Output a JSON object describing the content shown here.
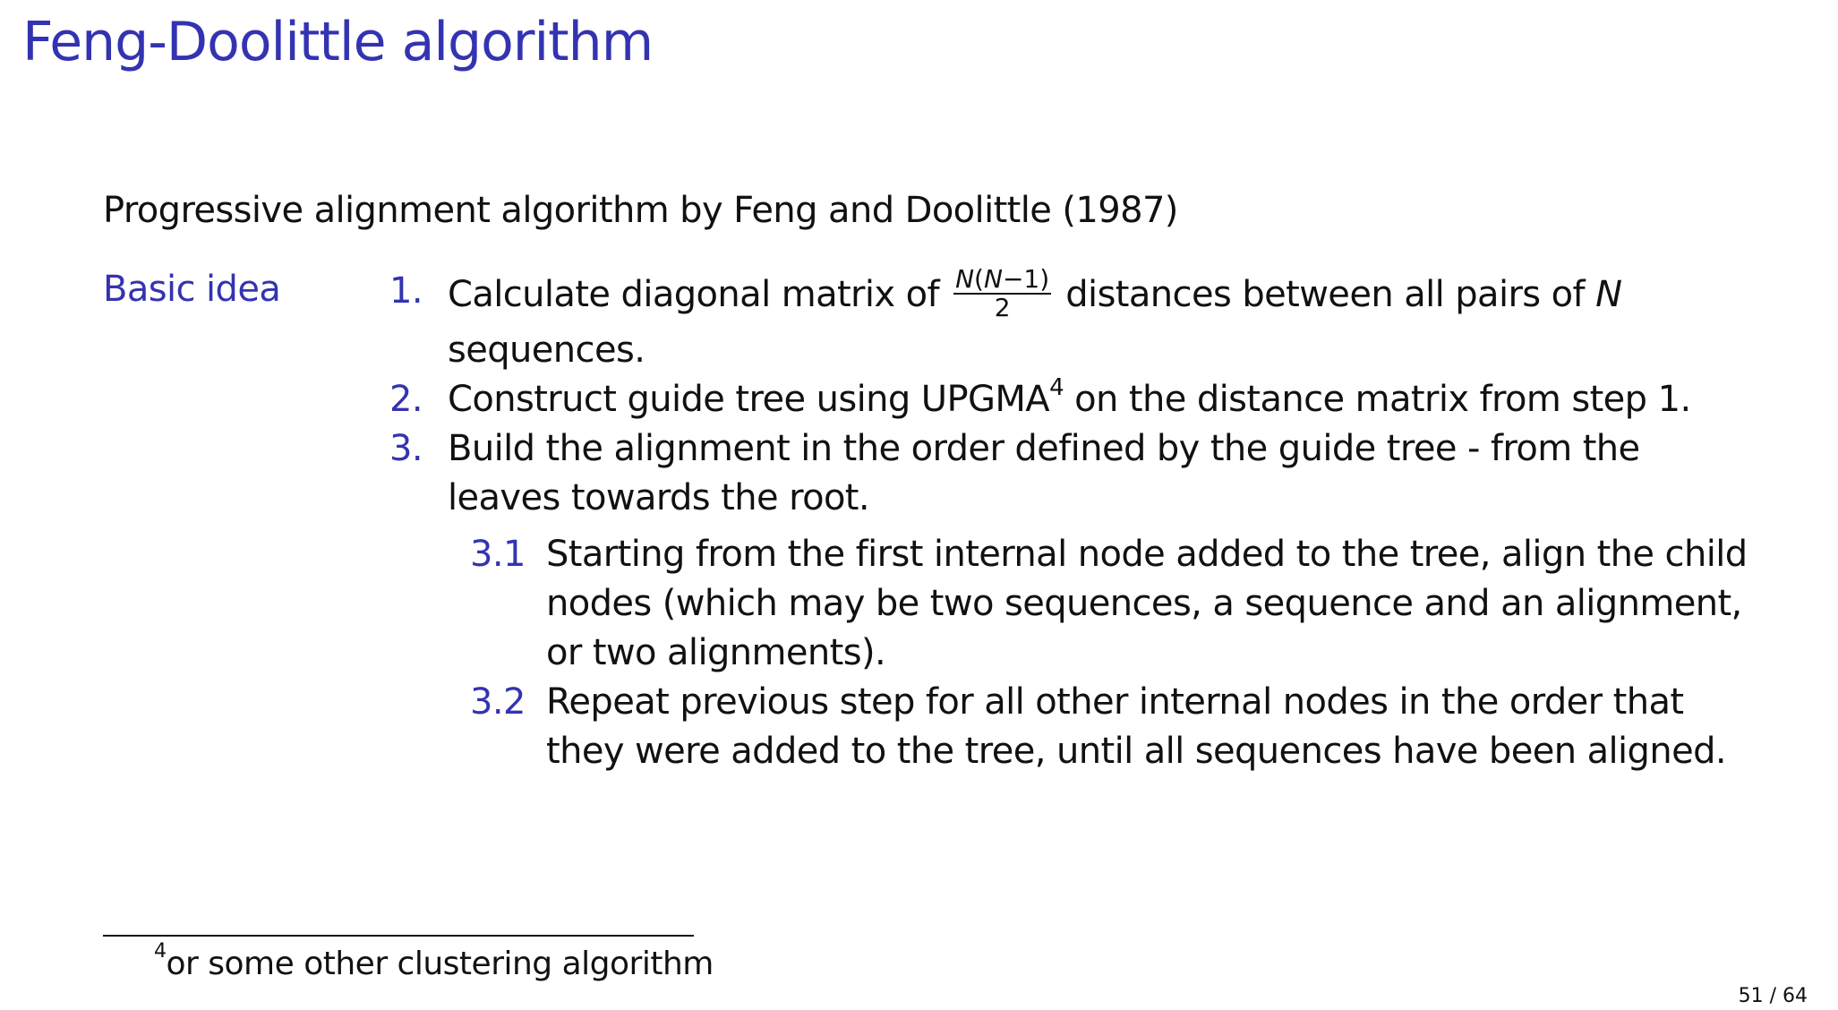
{
  "slide": {
    "title": "Feng-Doolittle algorithm",
    "intro": "Progressive alignment algorithm by Feng and Doolittle (1987)",
    "side_label": "Basic idea",
    "steps": [
      {
        "number": "1.",
        "text_before": "Calculate diagonal matrix of",
        "fraction_numerator_N1": "N",
        "fraction_numerator_mid": "(",
        "fraction_numerator_N2": "N",
        "fraction_numerator_end": "−1)",
        "fraction_denominator": "2",
        "text_after": "distances between all pairs of",
        "variable": "N",
        "text_end": "sequences."
      },
      {
        "number": "2.",
        "text_before": "Construct guide tree using UPGMA",
        "footnote_mark": "4",
        "text_after": "on the distance matrix from step 1."
      },
      {
        "number": "3.",
        "text": "Build the alignment in the order defined by the guide tree - from the leaves towards the root."
      }
    ],
    "substeps": [
      {
        "number": "3.1",
        "text": "Starting from the first internal node added to the tree, align the child nodes (which may be two sequences, a sequence and an alignment, or two alignments)."
      },
      {
        "number": "3.2",
        "text": "Repeat previous step for all other internal nodes in the order that they were added to the tree, until all sequences have been aligned."
      }
    ],
    "footnote": {
      "mark": "4",
      "text": "or some other clustering algorithm"
    },
    "page_number": "51 / 64"
  },
  "colors": {
    "accent": "#3333b2",
    "text": "#111111",
    "background": "#ffffff"
  }
}
